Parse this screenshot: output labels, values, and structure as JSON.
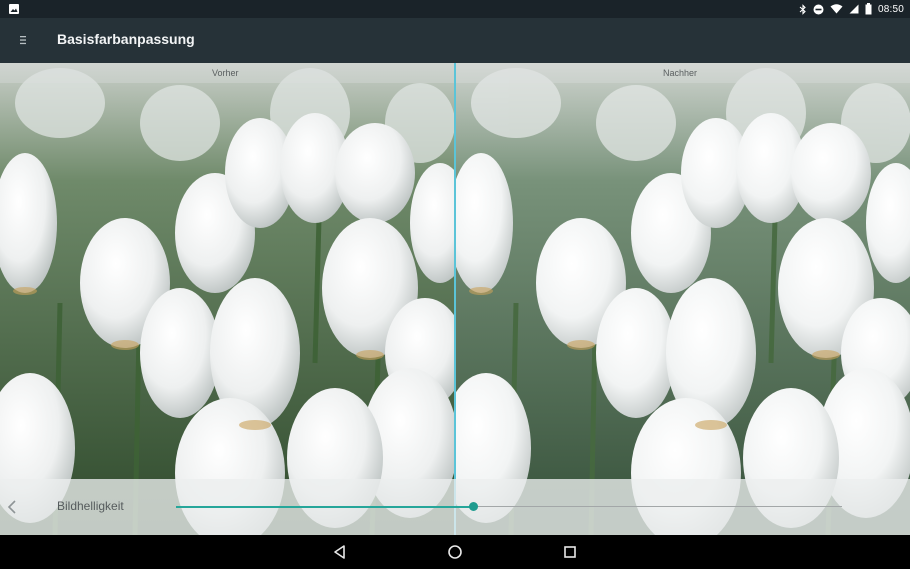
{
  "status_bar": {
    "time": "08:50",
    "icons": [
      "image-notification-icon",
      "bluetooth-icon",
      "do-not-disturb-icon",
      "wifi-icon",
      "cellular-signal-icon",
      "battery-icon"
    ]
  },
  "app_bar": {
    "menu_icon": "menu-icon",
    "title": "Basisfarbanpassung"
  },
  "preview": {
    "before_label": "Vorher",
    "after_label": "Nachher",
    "divider_color": "#5bc4d8"
  },
  "adjustment": {
    "back_icon": "chevron-left-icon",
    "parameter": "Bildhelligkeit",
    "slider_value": 0.446,
    "accent_color": "#26a69a"
  },
  "navigation_bar": {
    "icons": [
      "nav-back-icon",
      "nav-home-icon",
      "nav-recents-icon"
    ]
  }
}
